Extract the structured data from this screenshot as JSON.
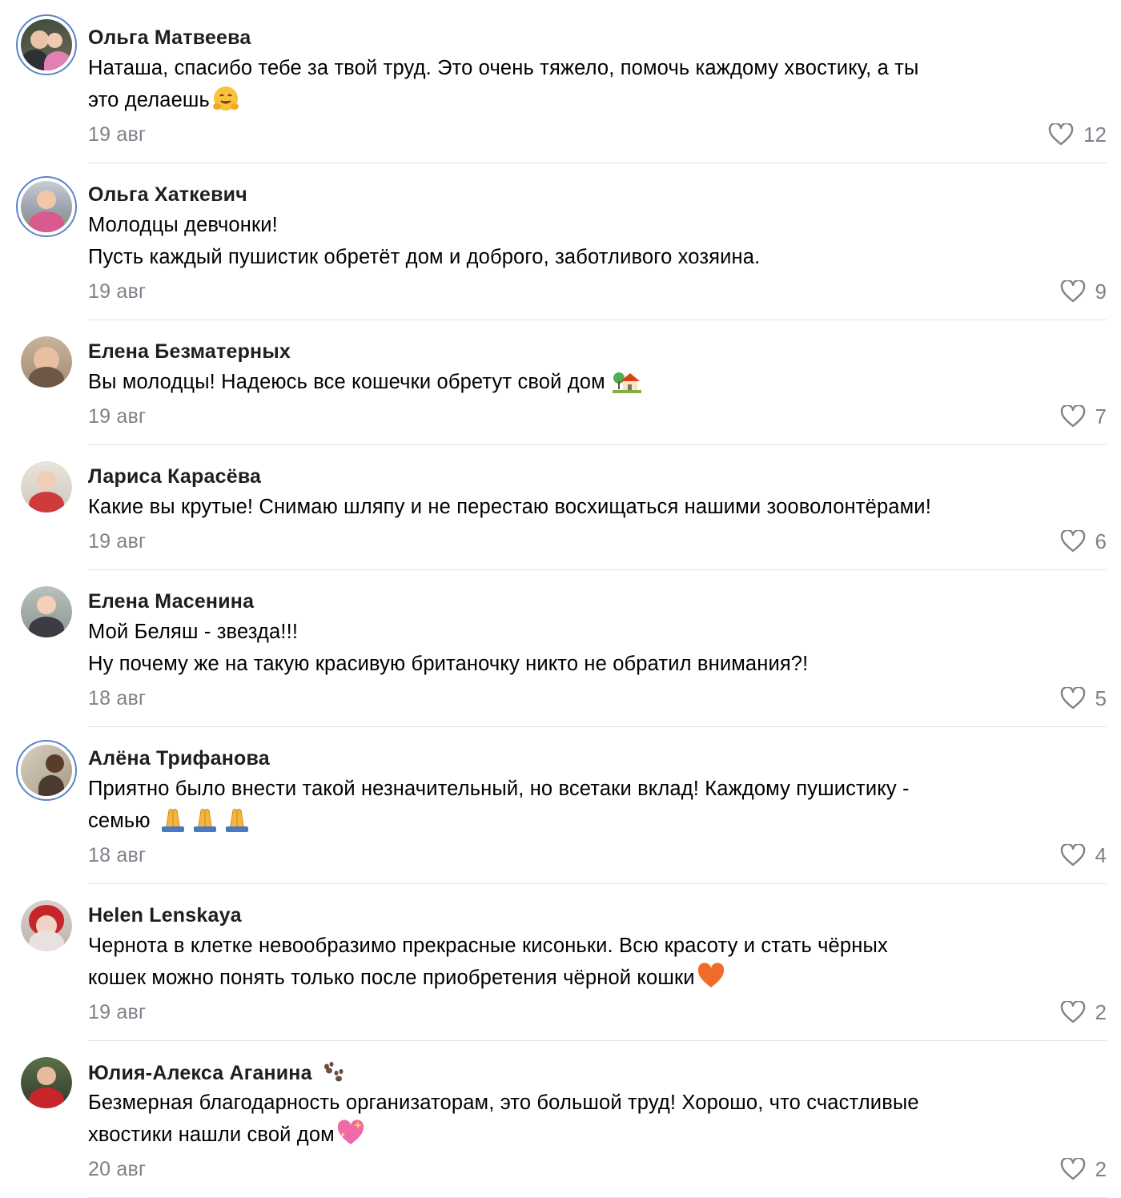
{
  "comments": [
    {
      "author": "Ольга Матвеева",
      "lines": [
        "Наташа, спасибо тебе за твой труд. Это очень тяжело, помочь каждому хвостику, а ты",
        "это делаешь"
      ],
      "date": "19 авг",
      "likes": "12",
      "avatar_icon": "avatar-photo",
      "emoji_icon": "hugging-face-emoji"
    },
    {
      "author": "Ольга Хаткевич",
      "lines": [
        "Молодцы девчонки!",
        "Пусть каждый пушистик обретёт дом и доброго, заботливого хозяина."
      ],
      "date": "19 авг",
      "likes": "9",
      "avatar_icon": "avatar-photo"
    },
    {
      "author": "Елена Безматерных",
      "lines": [
        "Вы молодцы! Надеюсь все кошечки обретут свой дом "
      ],
      "date": "19 авг",
      "likes": "7",
      "avatar_icon": "avatar-photo",
      "emoji_icon": "house-with-garden-emoji"
    },
    {
      "author": "Лариса Карасёва",
      "lines": [
        "Какие вы крутые! Снимаю шляпу и не перестаю восхищаться нашими зооволонтёрами!"
      ],
      "date": "19 авг",
      "likes": "6",
      "avatar_icon": "avatar-photo"
    },
    {
      "author": "Елена Масенина",
      "lines": [
        "Мой Беляш - звезда!!!",
        "Ну почему же на такую красивую британочку никто не обратил внимания?!"
      ],
      "date": "18 авг",
      "likes": "5",
      "avatar_icon": "avatar-photo"
    },
    {
      "author": "Алёна Трифанова",
      "lines": [
        "Приятно было внести такой незначительный, но всетаки вклад! Каждому пушистику -",
        "семью "
      ],
      "date": "18 авг",
      "likes": "4",
      "avatar_icon": "avatar-photo",
      "emoji_icon": "folded-hands-emoji"
    },
    {
      "author": "Helen Lenskaya",
      "lines": [
        "Чернота в клетке невообразимо прекрасные кисоньки. Всю красоту и стать чёрных",
        "кошек можно понять только после приобретения чёрной кошки"
      ],
      "date": "19 авг",
      "likes": "2",
      "avatar_icon": "avatar-photo",
      "emoji_icon": "orange-heart-emoji"
    },
    {
      "author": "Юлия-Алекса Аганина",
      "lines": [
        "Безмерная благодарность организаторам, это большой труд! Хорошо, что счастливые",
        "хвостики нашли свой дом"
      ],
      "date": "20 авг",
      "likes": "2",
      "avatar_icon": "avatar-photo",
      "author_icon": "paw-prints-icon",
      "emoji_icon": "sparkling-heart-emoji"
    }
  ],
  "colors": {
    "date_gray": "#7d8288",
    "divider": "#dfe1e5",
    "avatar_ring": "#5b85c8"
  }
}
